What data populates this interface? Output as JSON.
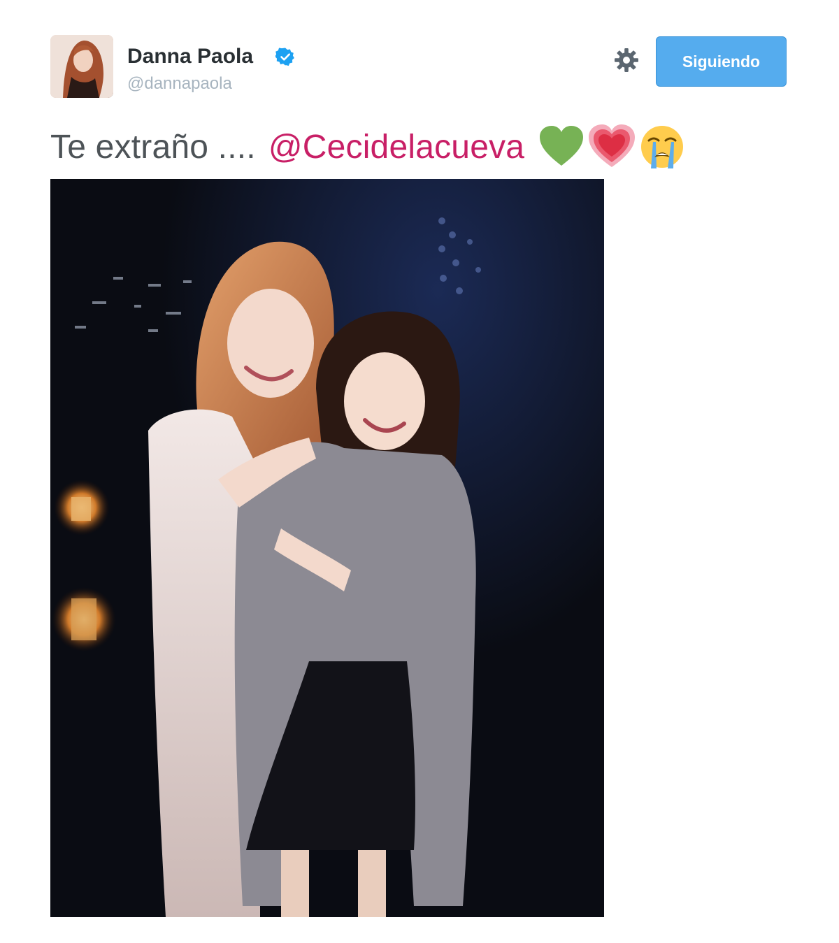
{
  "tweet": {
    "author": {
      "name": "Danna Paola",
      "handle": "@dannapaola",
      "verified": true
    },
    "follow_button": {
      "label": "Siguiendo"
    },
    "text": {
      "plain": "Te extraño ....",
      "mention": "@Cecidelacueva",
      "emojis": [
        "green-heart-icon",
        "growing-heart-icon",
        "loudly-crying-face-icon"
      ]
    },
    "media": {
      "type": "photo"
    }
  },
  "colors": {
    "brand_blue": "#55acee",
    "mention": "#c81f66",
    "text": "#4d5357",
    "name": "#292f33",
    "handle": "#a7b4bf",
    "verified": "#1da1f2"
  }
}
